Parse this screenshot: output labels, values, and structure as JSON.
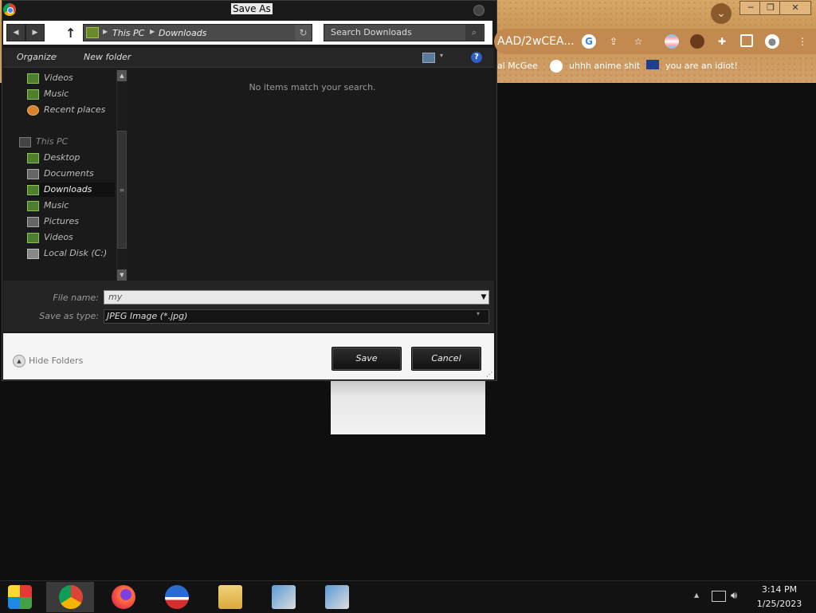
{
  "dialog": {
    "title": "Save As",
    "breadcrumb": [
      "This PC",
      "Downloads"
    ],
    "search_placeholder": "Search Downloads",
    "toolbar": {
      "organize": "Organize",
      "new_folder": "New folder"
    },
    "nav_items": [
      {
        "label": "Videos",
        "icon": "videos-folder-icon"
      },
      {
        "label": "Music",
        "icon": "music-folder-icon"
      },
      {
        "label": "Recent places",
        "icon": "recent-places-icon"
      },
      {
        "label": "This PC",
        "icon": "computer-icon"
      },
      {
        "label": "Desktop",
        "icon": "desktop-folder-icon"
      },
      {
        "label": "Documents",
        "icon": "documents-folder-icon"
      },
      {
        "label": "Downloads",
        "icon": "downloads-folder-icon",
        "selected": true
      },
      {
        "label": "Music",
        "icon": "music-folder-icon"
      },
      {
        "label": "Pictures",
        "icon": "pictures-folder-icon"
      },
      {
        "label": "Videos",
        "icon": "videos-folder-icon"
      },
      {
        "label": "Local Disk (C:)",
        "icon": "local-disk-icon"
      }
    ],
    "empty_message": "No items match your search.",
    "file_name_label": "File name:",
    "file_name_value": "my",
    "save_as_type_label": "Save as type:",
    "save_as_type_value": "JPEG Image (*.jpg)",
    "hide_folders": "Hide Folders",
    "save_button": "Save",
    "cancel_button": "Cancel"
  },
  "browser": {
    "url_fragment": "AAD/2wCEA...",
    "bookmarks": [
      "al McGee",
      "uhhh anime shit",
      "you are an idiot!"
    ]
  },
  "taskbar": {
    "apps": [
      "start-icon",
      "chrome-icon",
      "firefox-icon",
      "obama-logo-icon",
      "file-explorer-icon",
      "installer-icon",
      "installer-icon"
    ],
    "time": "3:14 PM",
    "date": "1/25/2023"
  }
}
